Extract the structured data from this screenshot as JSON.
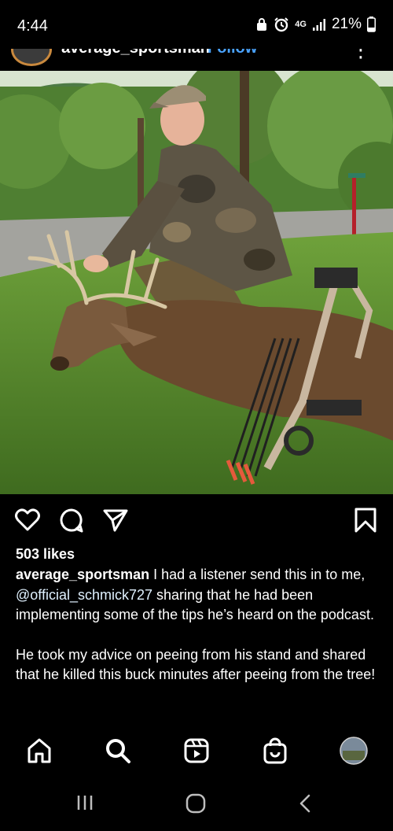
{
  "status_bar": {
    "time": "4:44",
    "network": "4G",
    "battery": "21%",
    "icons": [
      "alarm-icon",
      "lock-icon",
      "signal-icon",
      "battery-icon"
    ]
  },
  "post_header": {
    "username": "average_sportsman",
    "separator": "·",
    "follow": "Follow",
    "more": "⋮"
  },
  "post": {
    "likes": "503 likes",
    "caption_user": "average_sportsman",
    "caption_text_1": "I had a listener send this in to me,",
    "caption_mention": "@official_schmick727",
    "caption_text_2": "sharing that he had been implementing some of the tips he’s heard on the podcast.",
    "caption_paragraph_2": "He took my advice on peeing from his stand and shared that he killed this buck minutes after peeing from the tree!"
  },
  "actions": [
    "heart-icon",
    "comment-icon",
    "share-icon",
    "bookmark-icon"
  ],
  "bottom_nav": [
    "home-icon",
    "search-icon",
    "reels-icon",
    "shop-icon",
    "profile-avatar"
  ],
  "colors": {
    "background": "#000000",
    "follow": "#4aa3ff",
    "text": "#ffffff"
  }
}
